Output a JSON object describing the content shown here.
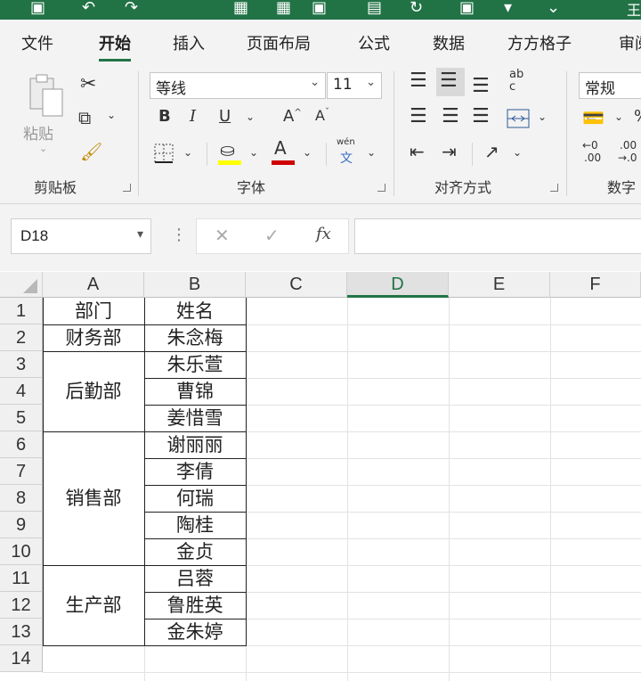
{
  "title_fragment": "王",
  "tabs": [
    "文件",
    "开始",
    "插入",
    "页面布局",
    "公式",
    "数据",
    "方方格子",
    "审阅"
  ],
  "ribbon": {
    "clipboard": {
      "paste_label": "粘贴",
      "group_label": "剪贴板"
    },
    "font": {
      "font_name": "等线",
      "font_size": "11",
      "bold": "B",
      "italic": "I",
      "underline": "U",
      "grow": "A",
      "shrink": "A",
      "font_color_glyph": "A",
      "phonetic_top": "wén",
      "phonetic_bottom": "文",
      "group_label": "字体"
    },
    "alignment": {
      "wrap_glyph_top": "ab",
      "wrap_glyph_bottom": "c",
      "group_label": "对齐方式"
    },
    "number": {
      "format": "常规",
      "group_label": "数字",
      "inc_decimal_top": "←0",
      "inc_decimal_bottom": ".00",
      "dec_decimal_top": ".00",
      "dec_decimal_bottom": "→.0"
    }
  },
  "formula_bar": {
    "name_box": "D18",
    "cancel": "✕",
    "enter": "✓",
    "fx": "fx",
    "formula": ""
  },
  "columns": [
    "A",
    "B",
    "C",
    "D",
    "E",
    "F"
  ],
  "selected_column": "D",
  "rows": [
    "1",
    "2",
    "3",
    "4",
    "5",
    "6",
    "7",
    "8",
    "9",
    "10",
    "11",
    "12",
    "13",
    "14"
  ],
  "table": {
    "headers": [
      "部门",
      "姓名"
    ],
    "departments": [
      {
        "name": "财务部",
        "rows": [
          2,
          2
        ]
      },
      {
        "name": "后勤部",
        "rows": [
          3,
          5
        ]
      },
      {
        "name": "销售部",
        "rows": [
          6,
          10
        ]
      },
      {
        "name": "生产部",
        "rows": [
          11,
          13
        ]
      }
    ],
    "names": [
      "朱念梅",
      "朱乐萱",
      "曹锦",
      "姜惜雪",
      "谢丽丽",
      "李倩",
      "何瑞",
      "陶桂",
      "金贞",
      "吕蓉",
      "鲁胜英",
      "金朱婷"
    ]
  },
  "colors": {
    "accent": "#217346",
    "font_underline": "#d00000",
    "highlight": "#ffff00"
  }
}
